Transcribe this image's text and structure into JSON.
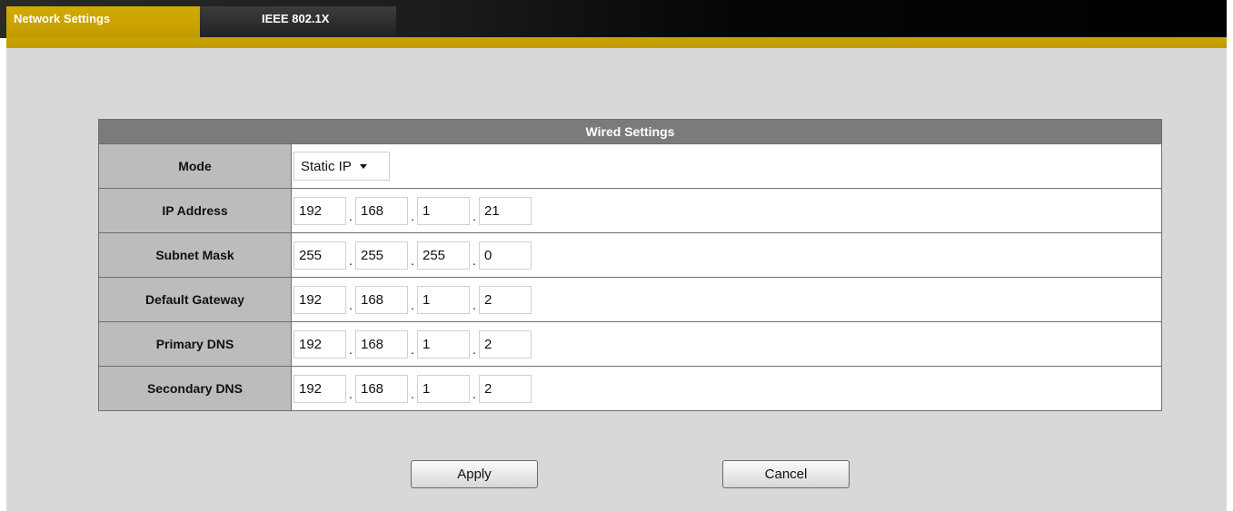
{
  "tabs": [
    {
      "label": "Network Settings",
      "active": true
    },
    {
      "label": "IEEE 802.1X",
      "active": false
    }
  ],
  "wired_settings": {
    "title": "Wired Settings",
    "mode": {
      "label": "Mode",
      "value": "Static IP"
    },
    "rows": [
      {
        "label": "IP Address",
        "octets": [
          "192",
          "168",
          "1",
          "21"
        ]
      },
      {
        "label": "Subnet Mask",
        "octets": [
          "255",
          "255",
          "255",
          "0"
        ]
      },
      {
        "label": "Default Gateway",
        "octets": [
          "192",
          "168",
          "1",
          "2"
        ]
      },
      {
        "label": "Primary DNS",
        "octets": [
          "192",
          "168",
          "1",
          "2"
        ]
      },
      {
        "label": "Secondary DNS",
        "octets": [
          "192",
          "168",
          "1",
          "2"
        ]
      }
    ],
    "separator": "."
  },
  "buttons": {
    "apply": "Apply",
    "cancel": "Cancel"
  },
  "colors": {
    "tab_active": "#c9a300",
    "header_bg": "#7b7b7b",
    "label_bg": "#bcbcbc",
    "content_bg": "#d8d8d8"
  },
  "icons": {
    "mode_select": "chevron-down-icon"
  }
}
